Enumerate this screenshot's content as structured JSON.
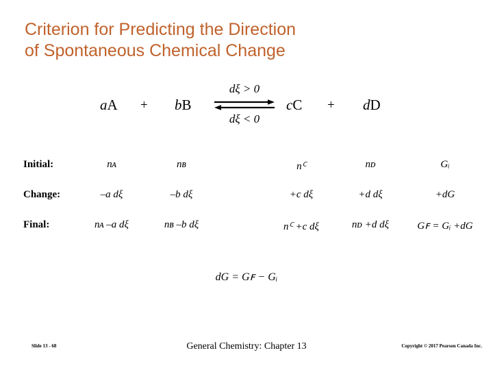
{
  "slide": {
    "background_color": "#FFFFFF",
    "title_color": "#C0622C",
    "text_color": "#000000",
    "title": {
      "line1": "Criterion for Predicting the Direction",
      "line2": "of Spontaneous Chemical Change"
    },
    "equation": {
      "reactant_a_coef": "a",
      "reactant_a_elem": "A",
      "plus_left": "+",
      "reactant_b_coef": "b",
      "reactant_b_elem": "B",
      "arrow_label_forward": "dξ > 0",
      "arrow_label_reverse": "dξ < 0",
      "arrow_icon": "equilibrium-double-arrow",
      "product_c_coef": "c",
      "product_c_elem": "C",
      "plus_right": "+",
      "product_d_coef": "d",
      "product_d_elem": "D"
    },
    "table": {
      "rows": [
        {
          "label": "Initial:",
          "col_a": "nᴀ",
          "col_b": "nʙ",
          "col_c": "nꟲ",
          "col_d": "nᴅ",
          "col_g": "Gᵢ"
        },
        {
          "label": "Change:",
          "col_a": "–a dξ",
          "col_b": "–b dξ",
          "col_c": "+c dξ",
          "col_d": "+d dξ",
          "col_g": "+dG"
        },
        {
          "label": "Final:",
          "col_a": "nᴀ –a dξ",
          "col_b": "nʙ –b dξ",
          "col_c": "nꟲ +c dξ",
          "col_d": "nᴅ +d dξ",
          "col_g": "Gꜰ = Gᵢ +dG"
        }
      ]
    },
    "summary_formula": "dG = Gꜰ − Gᵢ",
    "footer": {
      "slide_number": "Slide 13 - 68",
      "center_text": "General Chemistry: Chapter 13",
      "copyright": "Copyright © 2017 Pearson Canada Inc."
    }
  }
}
